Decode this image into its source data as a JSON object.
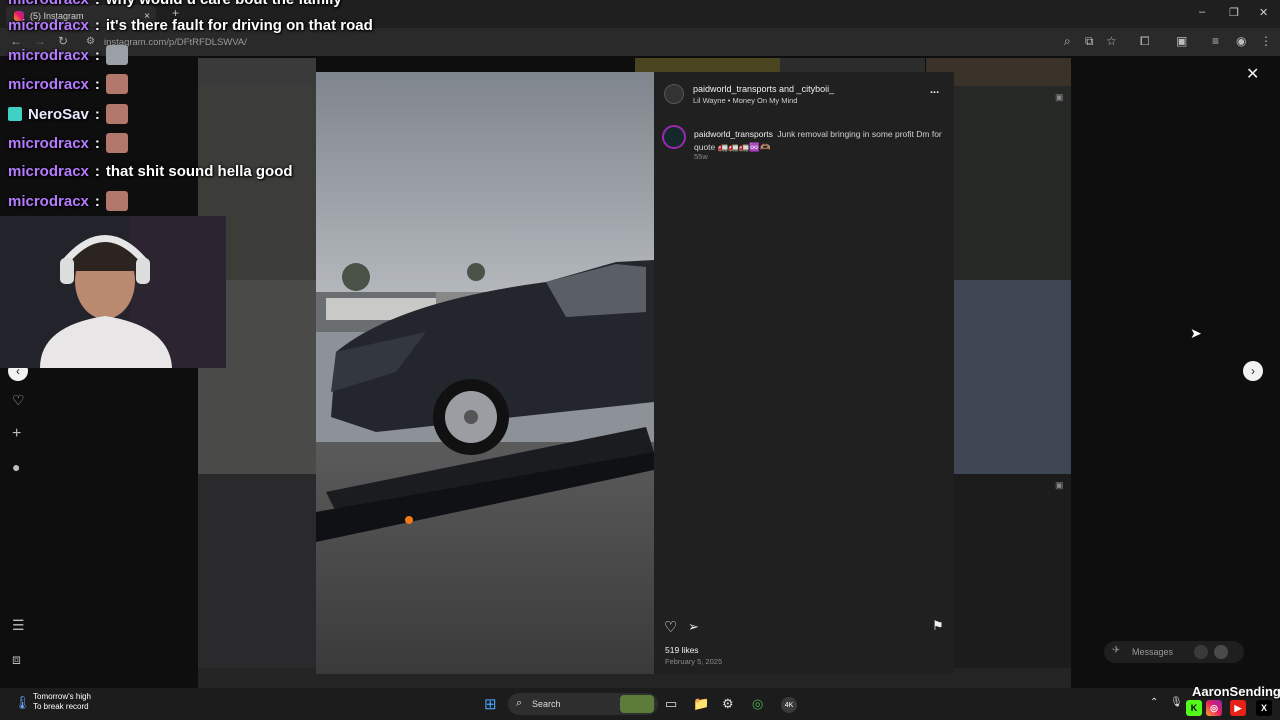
{
  "browser": {
    "tab_title": "(5) Instagram",
    "new_tab": "+",
    "tab_close": "×",
    "url": "instagram.com/p/DFtRFDLSWVA/",
    "window_controls": [
      "–",
      "❐",
      "✕"
    ]
  },
  "chat": {
    "messages": [
      {
        "user": "microdracx",
        "text": "why would u care bout the family",
        "emote": false
      },
      {
        "user": "microdracx",
        "text": "it's there fault for driving on that road",
        "emote": false
      },
      {
        "user": "microdracx",
        "text": "",
        "emote": true
      },
      {
        "user": "microdracx",
        "text": "",
        "emote": true
      },
      {
        "user": "NeroSav",
        "text": "",
        "emote": true
      },
      {
        "user": "microdracx",
        "text": "",
        "emote": true
      },
      {
        "user": "microdracx",
        "text": "that shit sound hella good",
        "emote": false
      },
      {
        "user": "microdracx",
        "text": "",
        "emote": true
      }
    ],
    "separator": ":"
  },
  "post": {
    "header_users": "paidworld_transports and _cityboii_",
    "audio": "Lil Wayne • Money On My Mind",
    "more": "...",
    "caption_user": "paidworld_transports",
    "caption_text": "Junk removal bringing in some profit Dm for quote 🚛🚛🚛♾️🫶🏽",
    "caption_age": "55w",
    "likes": "519 likes",
    "date": "February 5, 2025"
  },
  "overlay": {
    "messages_label": "Messages",
    "streamer_name": "AaronSending"
  },
  "taskbar": {
    "weather_title": "Tomorrow's high",
    "weather_sub": "To break record",
    "search_label": "Search",
    "app_label_4k": "4K"
  },
  "colors": {
    "chat_name": "#b57bff",
    "panel_bg": "#202020",
    "accent_ring": "#9c27b0"
  }
}
